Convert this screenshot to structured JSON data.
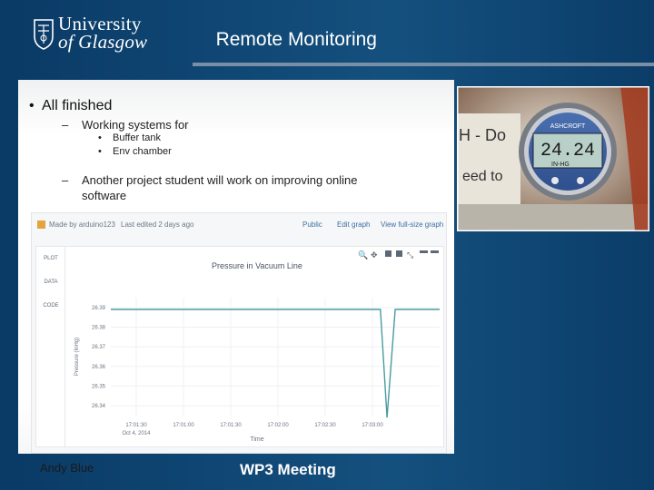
{
  "header": {
    "logo_line1": "University",
    "logo_line2": "of Glasgow",
    "title": "Remote Monitoring"
  },
  "body": {
    "bullet": "All finished",
    "sub1": "Working systems for",
    "subsub": [
      "Buffer tank",
      "Env chamber"
    ],
    "sub2_line1": "Another project student will work on improving online",
    "sub2_line2": "software"
  },
  "graph": {
    "made_by": "Made by arduino123",
    "edited": "Last edited 2 days ago",
    "public": "Public",
    "edit_graph": "Edit graph",
    "view_graph": "View full-size graph",
    "tabs": [
      "PLOT",
      "DATA",
      "CODE"
    ]
  },
  "chart_data": {
    "type": "line",
    "title": "Pressure in Vacuum Line",
    "xlabel": "Time",
    "ylabel": "Pressure (InHg)",
    "x_ticks": [
      "17:01:30",
      "17:01:00",
      "17:01:30",
      "17:02:00",
      "17:02:30",
      "17:03:00"
    ],
    "x_date_label": "Oct 4, 2014",
    "y_ticks": [
      "26.39",
      "26.38",
      "26.37",
      "26.36",
      "26.35",
      "26.34"
    ],
    "ylim": [
      26.335,
      26.395
    ],
    "series": [
      {
        "name": "",
        "x": [
          0,
          0.82,
          0.84,
          0.865,
          1.0
        ],
        "values": [
          26.389,
          26.389,
          26.334,
          26.389,
          26.389
        ]
      }
    ],
    "line_color": "#4a9aa0"
  },
  "footer": {
    "author": "Andy Blue",
    "meeting": "WP3 Meeting"
  }
}
